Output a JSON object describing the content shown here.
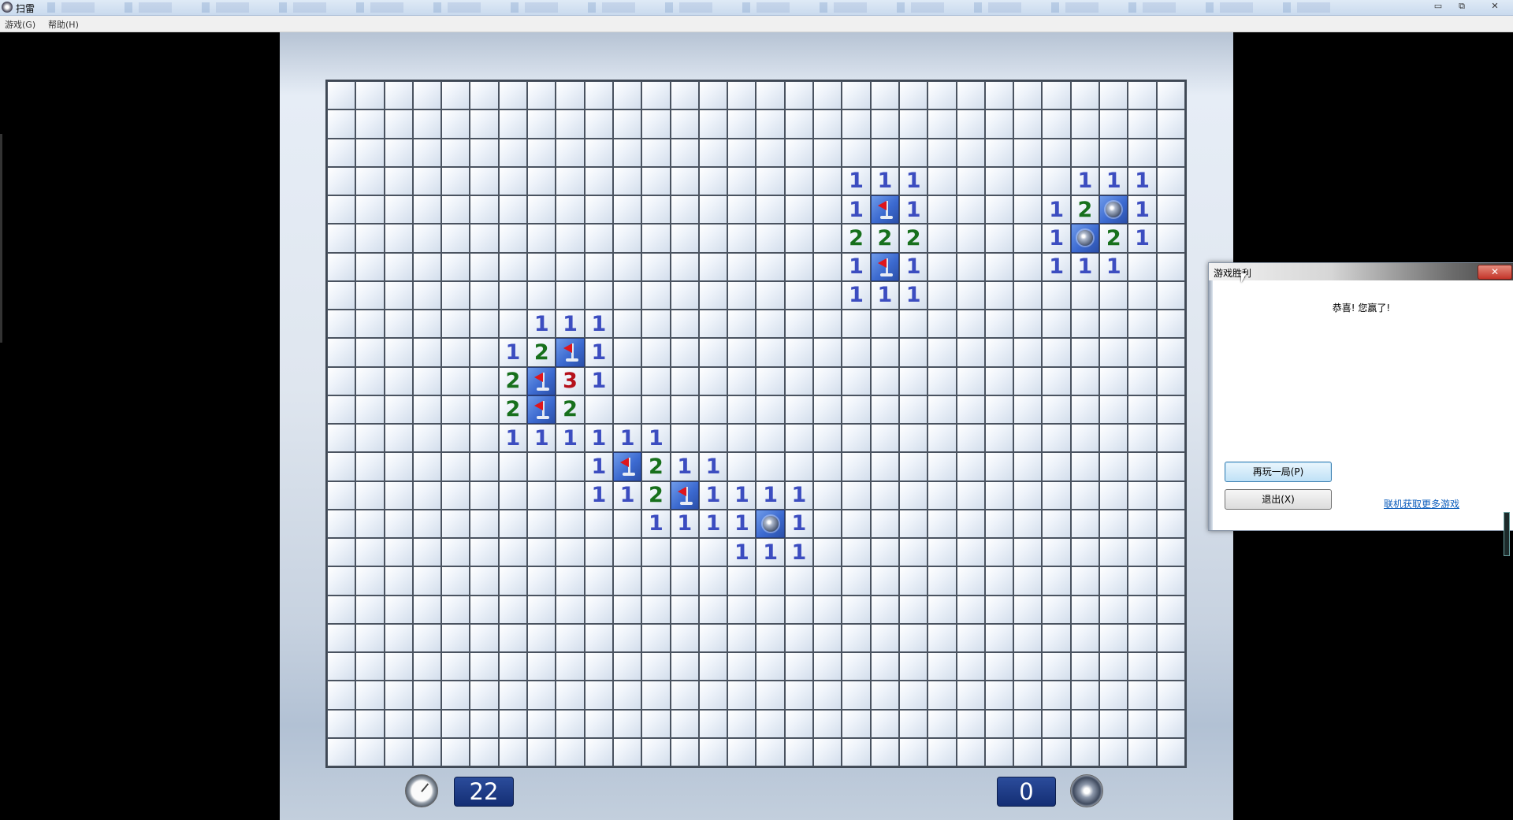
{
  "window": {
    "title": "扫雷"
  },
  "menu": {
    "game": "游戏(G)",
    "help": "帮助(H)"
  },
  "board": {
    "rows": 24,
    "cols": 30,
    "cells": [
      {
        "r": 3,
        "c": 18,
        "t": "1"
      },
      {
        "r": 3,
        "c": 19,
        "t": "1"
      },
      {
        "r": 3,
        "c": 20,
        "t": "1"
      },
      {
        "r": 3,
        "c": 26,
        "t": "1"
      },
      {
        "r": 3,
        "c": 27,
        "t": "1"
      },
      {
        "r": 3,
        "c": 28,
        "t": "1"
      },
      {
        "r": 4,
        "c": 18,
        "t": "1"
      },
      {
        "r": 4,
        "c": 19,
        "t": "F"
      },
      {
        "r": 4,
        "c": 20,
        "t": "1"
      },
      {
        "r": 4,
        "c": 25,
        "t": "1"
      },
      {
        "r": 4,
        "c": 26,
        "t": "2"
      },
      {
        "r": 4,
        "c": 27,
        "t": "M"
      },
      {
        "r": 4,
        "c": 28,
        "t": "1"
      },
      {
        "r": 5,
        "c": 18,
        "t": "2"
      },
      {
        "r": 5,
        "c": 19,
        "t": "2"
      },
      {
        "r": 5,
        "c": 20,
        "t": "2"
      },
      {
        "r": 5,
        "c": 25,
        "t": "1"
      },
      {
        "r": 5,
        "c": 26,
        "t": "M"
      },
      {
        "r": 5,
        "c": 27,
        "t": "2"
      },
      {
        "r": 5,
        "c": 28,
        "t": "1"
      },
      {
        "r": 6,
        "c": 18,
        "t": "1"
      },
      {
        "r": 6,
        "c": 19,
        "t": "F"
      },
      {
        "r": 6,
        "c": 20,
        "t": "1"
      },
      {
        "r": 6,
        "c": 25,
        "t": "1"
      },
      {
        "r": 6,
        "c": 26,
        "t": "1"
      },
      {
        "r": 6,
        "c": 27,
        "t": "1"
      },
      {
        "r": 7,
        "c": 18,
        "t": "1"
      },
      {
        "r": 7,
        "c": 19,
        "t": "1"
      },
      {
        "r": 7,
        "c": 20,
        "t": "1"
      },
      {
        "r": 8,
        "c": 7,
        "t": "1"
      },
      {
        "r": 8,
        "c": 8,
        "t": "1"
      },
      {
        "r": 8,
        "c": 9,
        "t": "1"
      },
      {
        "r": 9,
        "c": 6,
        "t": "1"
      },
      {
        "r": 9,
        "c": 7,
        "t": "2"
      },
      {
        "r": 9,
        "c": 8,
        "t": "F"
      },
      {
        "r": 9,
        "c": 9,
        "t": "1"
      },
      {
        "r": 10,
        "c": 6,
        "t": "2"
      },
      {
        "r": 10,
        "c": 7,
        "t": "F"
      },
      {
        "r": 10,
        "c": 8,
        "t": "3"
      },
      {
        "r": 10,
        "c": 9,
        "t": "1"
      },
      {
        "r": 11,
        "c": 6,
        "t": "2"
      },
      {
        "r": 11,
        "c": 7,
        "t": "F"
      },
      {
        "r": 11,
        "c": 8,
        "t": "2"
      },
      {
        "r": 12,
        "c": 6,
        "t": "1"
      },
      {
        "r": 12,
        "c": 7,
        "t": "1"
      },
      {
        "r": 12,
        "c": 8,
        "t": "1"
      },
      {
        "r": 12,
        "c": 9,
        "t": "1"
      },
      {
        "r": 12,
        "c": 10,
        "t": "1"
      },
      {
        "r": 12,
        "c": 11,
        "t": "1"
      },
      {
        "r": 13,
        "c": 9,
        "t": "1"
      },
      {
        "r": 13,
        "c": 10,
        "t": "F"
      },
      {
        "r": 13,
        "c": 11,
        "t": "2"
      },
      {
        "r": 13,
        "c": 12,
        "t": "1"
      },
      {
        "r": 13,
        "c": 13,
        "t": "1"
      },
      {
        "r": 14,
        "c": 9,
        "t": "1"
      },
      {
        "r": 14,
        "c": 10,
        "t": "1"
      },
      {
        "r": 14,
        "c": 11,
        "t": "2"
      },
      {
        "r": 14,
        "c": 12,
        "t": "F"
      },
      {
        "r": 14,
        "c": 13,
        "t": "1"
      },
      {
        "r": 14,
        "c": 14,
        "t": "1"
      },
      {
        "r": 14,
        "c": 15,
        "t": "1"
      },
      {
        "r": 14,
        "c": 16,
        "t": "1"
      },
      {
        "r": 15,
        "c": 11,
        "t": "1"
      },
      {
        "r": 15,
        "c": 12,
        "t": "1"
      },
      {
        "r": 15,
        "c": 13,
        "t": "1"
      },
      {
        "r": 15,
        "c": 14,
        "t": "1"
      },
      {
        "r": 15,
        "c": 15,
        "t": "M"
      },
      {
        "r": 15,
        "c": 16,
        "t": "1"
      },
      {
        "r": 16,
        "c": 14,
        "t": "1"
      },
      {
        "r": 16,
        "c": 15,
        "t": "1"
      },
      {
        "r": 16,
        "c": 16,
        "t": "1"
      }
    ]
  },
  "status": {
    "time": "22",
    "mines_remaining": "0"
  },
  "dialog": {
    "title": "游戏胜利",
    "close": "✕",
    "message": "恭喜! 您赢了!",
    "play_again": "再玩一局(P)",
    "exit": "退出(X)",
    "more_games_link": "联机获取更多游戏"
  },
  "icons": {
    "flag": "flag-icon",
    "mine": "mine-icon",
    "clock": "clock-icon"
  }
}
